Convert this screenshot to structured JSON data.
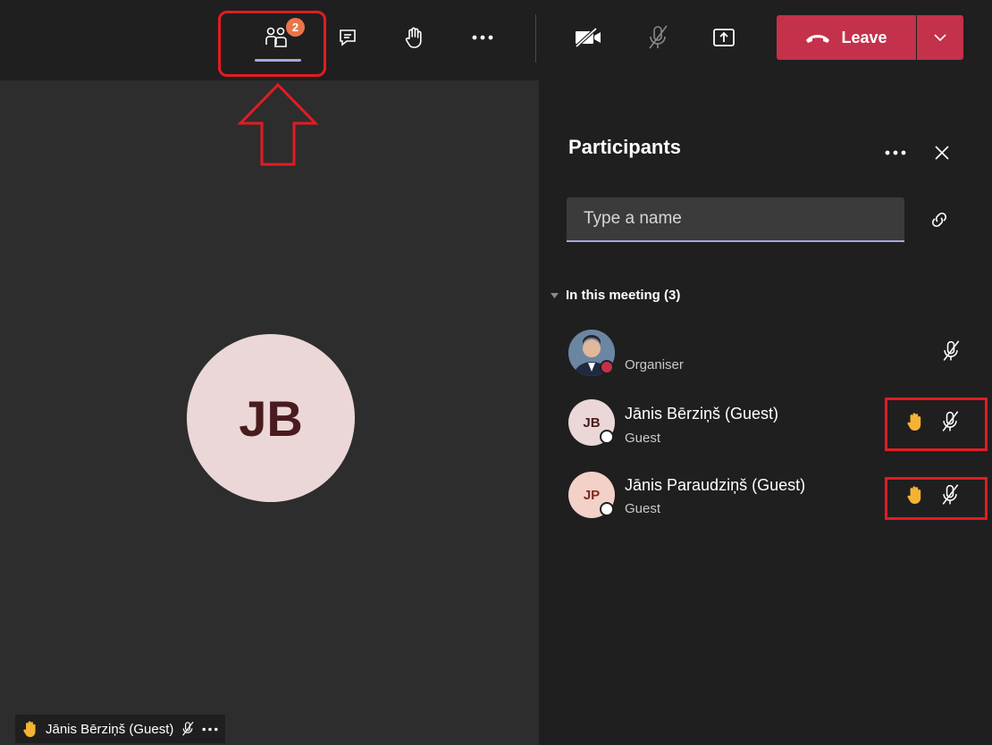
{
  "toolbar": {
    "participants_badge": "2",
    "leave_label": "Leave",
    "icons": [
      "participants-icon",
      "chat-icon",
      "raise-hand-icon",
      "more-icon",
      "camera-off-icon",
      "mic-off-icon",
      "share-icon",
      "phone-icon",
      "chevron-down-icon"
    ]
  },
  "stage": {
    "avatar_initials": "JB",
    "name_tag": "Jānis Bērziņš (Guest)"
  },
  "panel": {
    "title": "Participants",
    "search_placeholder": "Type a name",
    "section_label": "In this meeting (3)",
    "participants": [
      {
        "name": "",
        "role": "Organiser",
        "initials": "",
        "status_color": "#c4314b"
      },
      {
        "name": "Jānis Bērziņš (Guest)",
        "role": "Guest",
        "initials": "JB",
        "hand_raised": true
      },
      {
        "name": "Jānis Paraudziņš (Guest)",
        "role": "Guest",
        "initials": "JP",
        "hand_raised": true
      }
    ]
  },
  "colors": {
    "leave": "#c4314b",
    "accent": "#a6a7dc",
    "badge": "#e97548",
    "annotation": "#e31b23",
    "hand": "#f5b335"
  }
}
